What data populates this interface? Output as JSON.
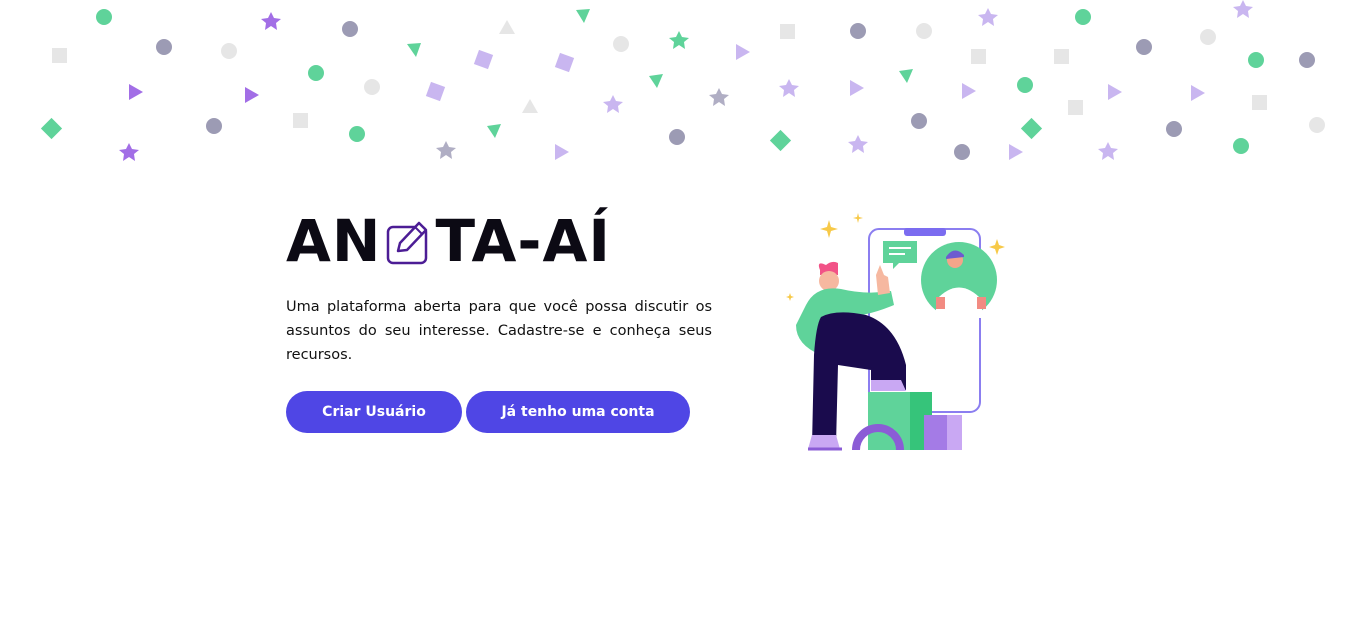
{
  "brand": {
    "name_part1": "AN",
    "name_part2": "TA-AÍ",
    "pen_icon": "pen-square-icon"
  },
  "hero": {
    "description": "Uma plataforma aberta para que você possa discutir os assuntos do seu interesse. Cadastre-se e conheça seus recursos."
  },
  "actions": {
    "create_user_label": "Criar Usuário",
    "login_label": "Já tenho uma conta"
  },
  "colors": {
    "accent": "#4f46e5",
    "green": "#5fd39a",
    "purple": "#9b6fe0",
    "gray": "#8a8aa0"
  },
  "illustration": "person-with-phone-chat-illustration"
}
